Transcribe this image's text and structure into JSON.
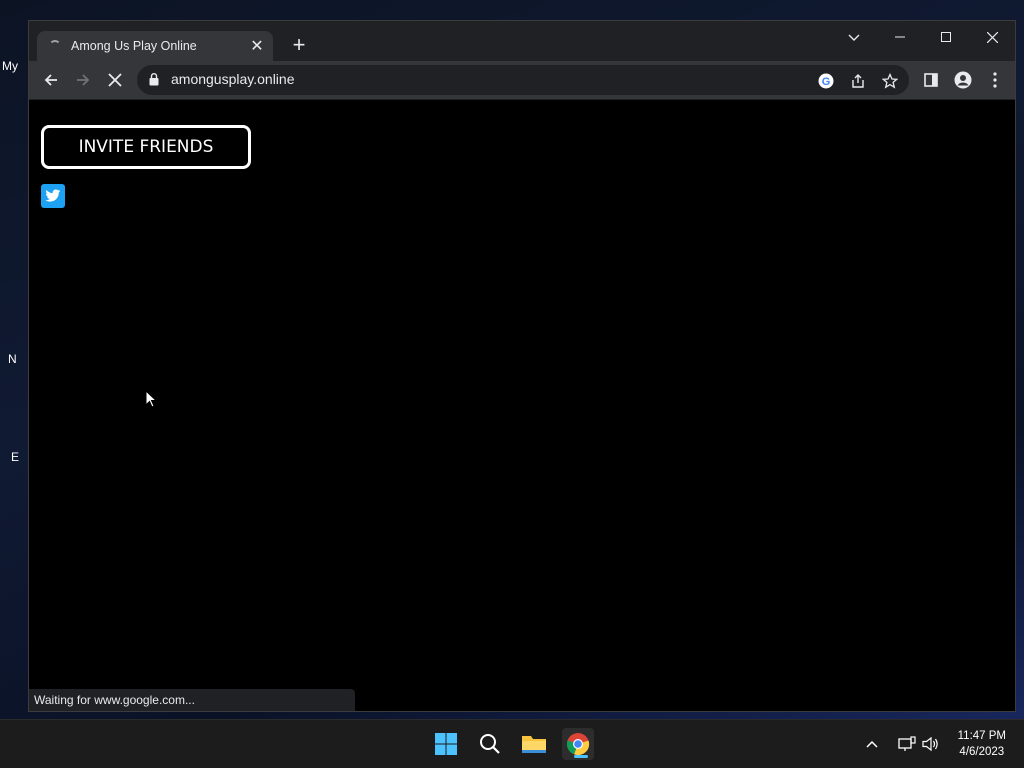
{
  "desktop": {
    "fragments": [
      "My",
      "N",
      "E"
    ]
  },
  "browser": {
    "tab": {
      "title": "Among Us Play Online"
    },
    "window_controls": [
      "minimize",
      "maximize",
      "close"
    ],
    "address_bar": {
      "url": "amongusplay.online"
    },
    "status_text": "Waiting for www.google.com..."
  },
  "page": {
    "invite_button_label": "INVITE FRIENDS",
    "twitter_icon": "twitter-icon"
  },
  "taskbar": {
    "apps": [
      "windows-start-icon",
      "search-icon",
      "file-explorer-icon",
      "chrome-icon"
    ],
    "time": "11:47 PM",
    "date": "4/6/2023"
  },
  "colors": {
    "twitter": "#1da1f2",
    "accent": "#4cc2ff"
  }
}
